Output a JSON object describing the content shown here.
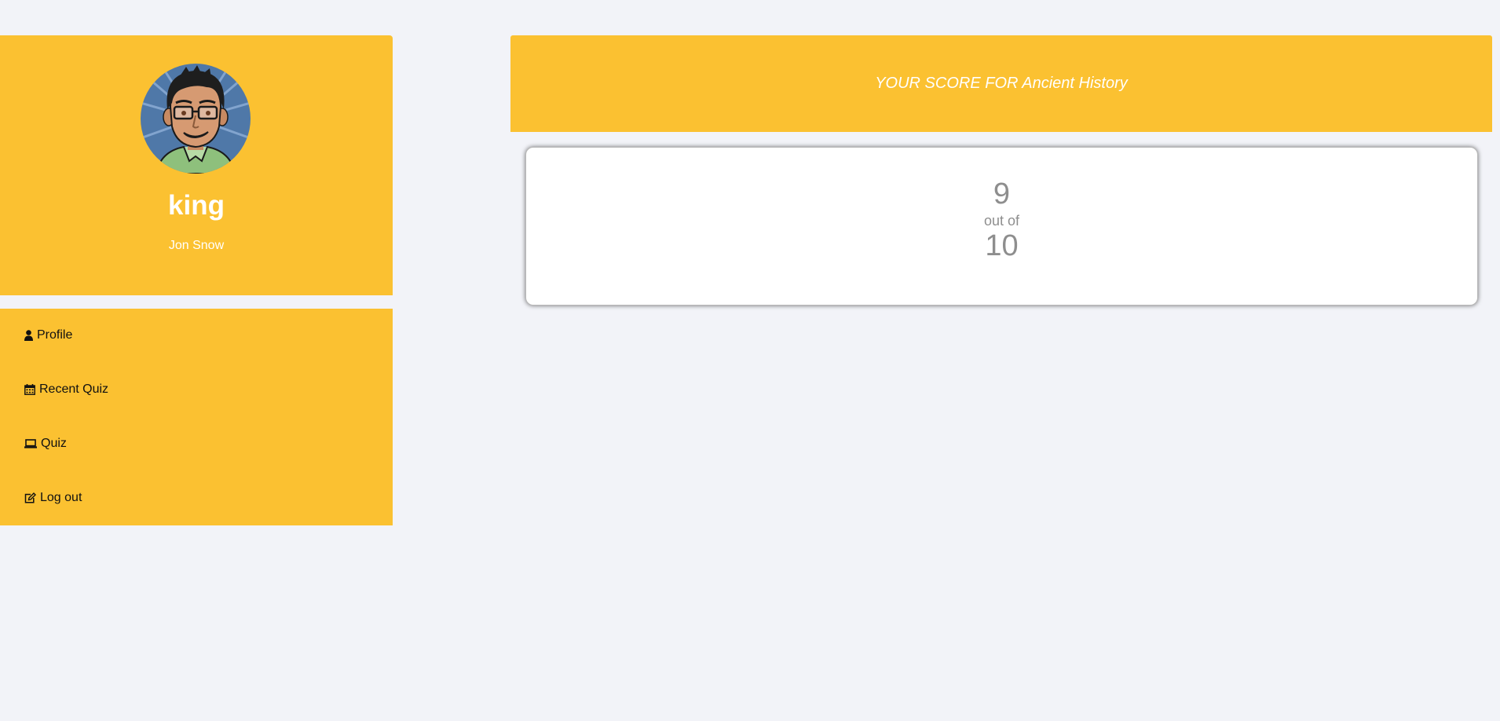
{
  "profile": {
    "username": "king",
    "full_name": "Jon Snow",
    "avatar_icon": "cartoon-man-with-glasses-avatar"
  },
  "nav": {
    "items": [
      {
        "label": "Profile",
        "icon": "user-icon"
      },
      {
        "label": "Recent Quiz",
        "icon": "calendar-icon"
      },
      {
        "label": "Quiz",
        "icon": "laptop-icon"
      },
      {
        "label": "Log out",
        "icon": "edit-icon"
      }
    ]
  },
  "score": {
    "title": "YOUR SCORE FOR Ancient History",
    "correct": "9",
    "separator": "out of",
    "total": "10"
  },
  "colors": {
    "accent": "#fbc131",
    "background": "#f2f3f8",
    "score_text": "#8e8e8e"
  }
}
